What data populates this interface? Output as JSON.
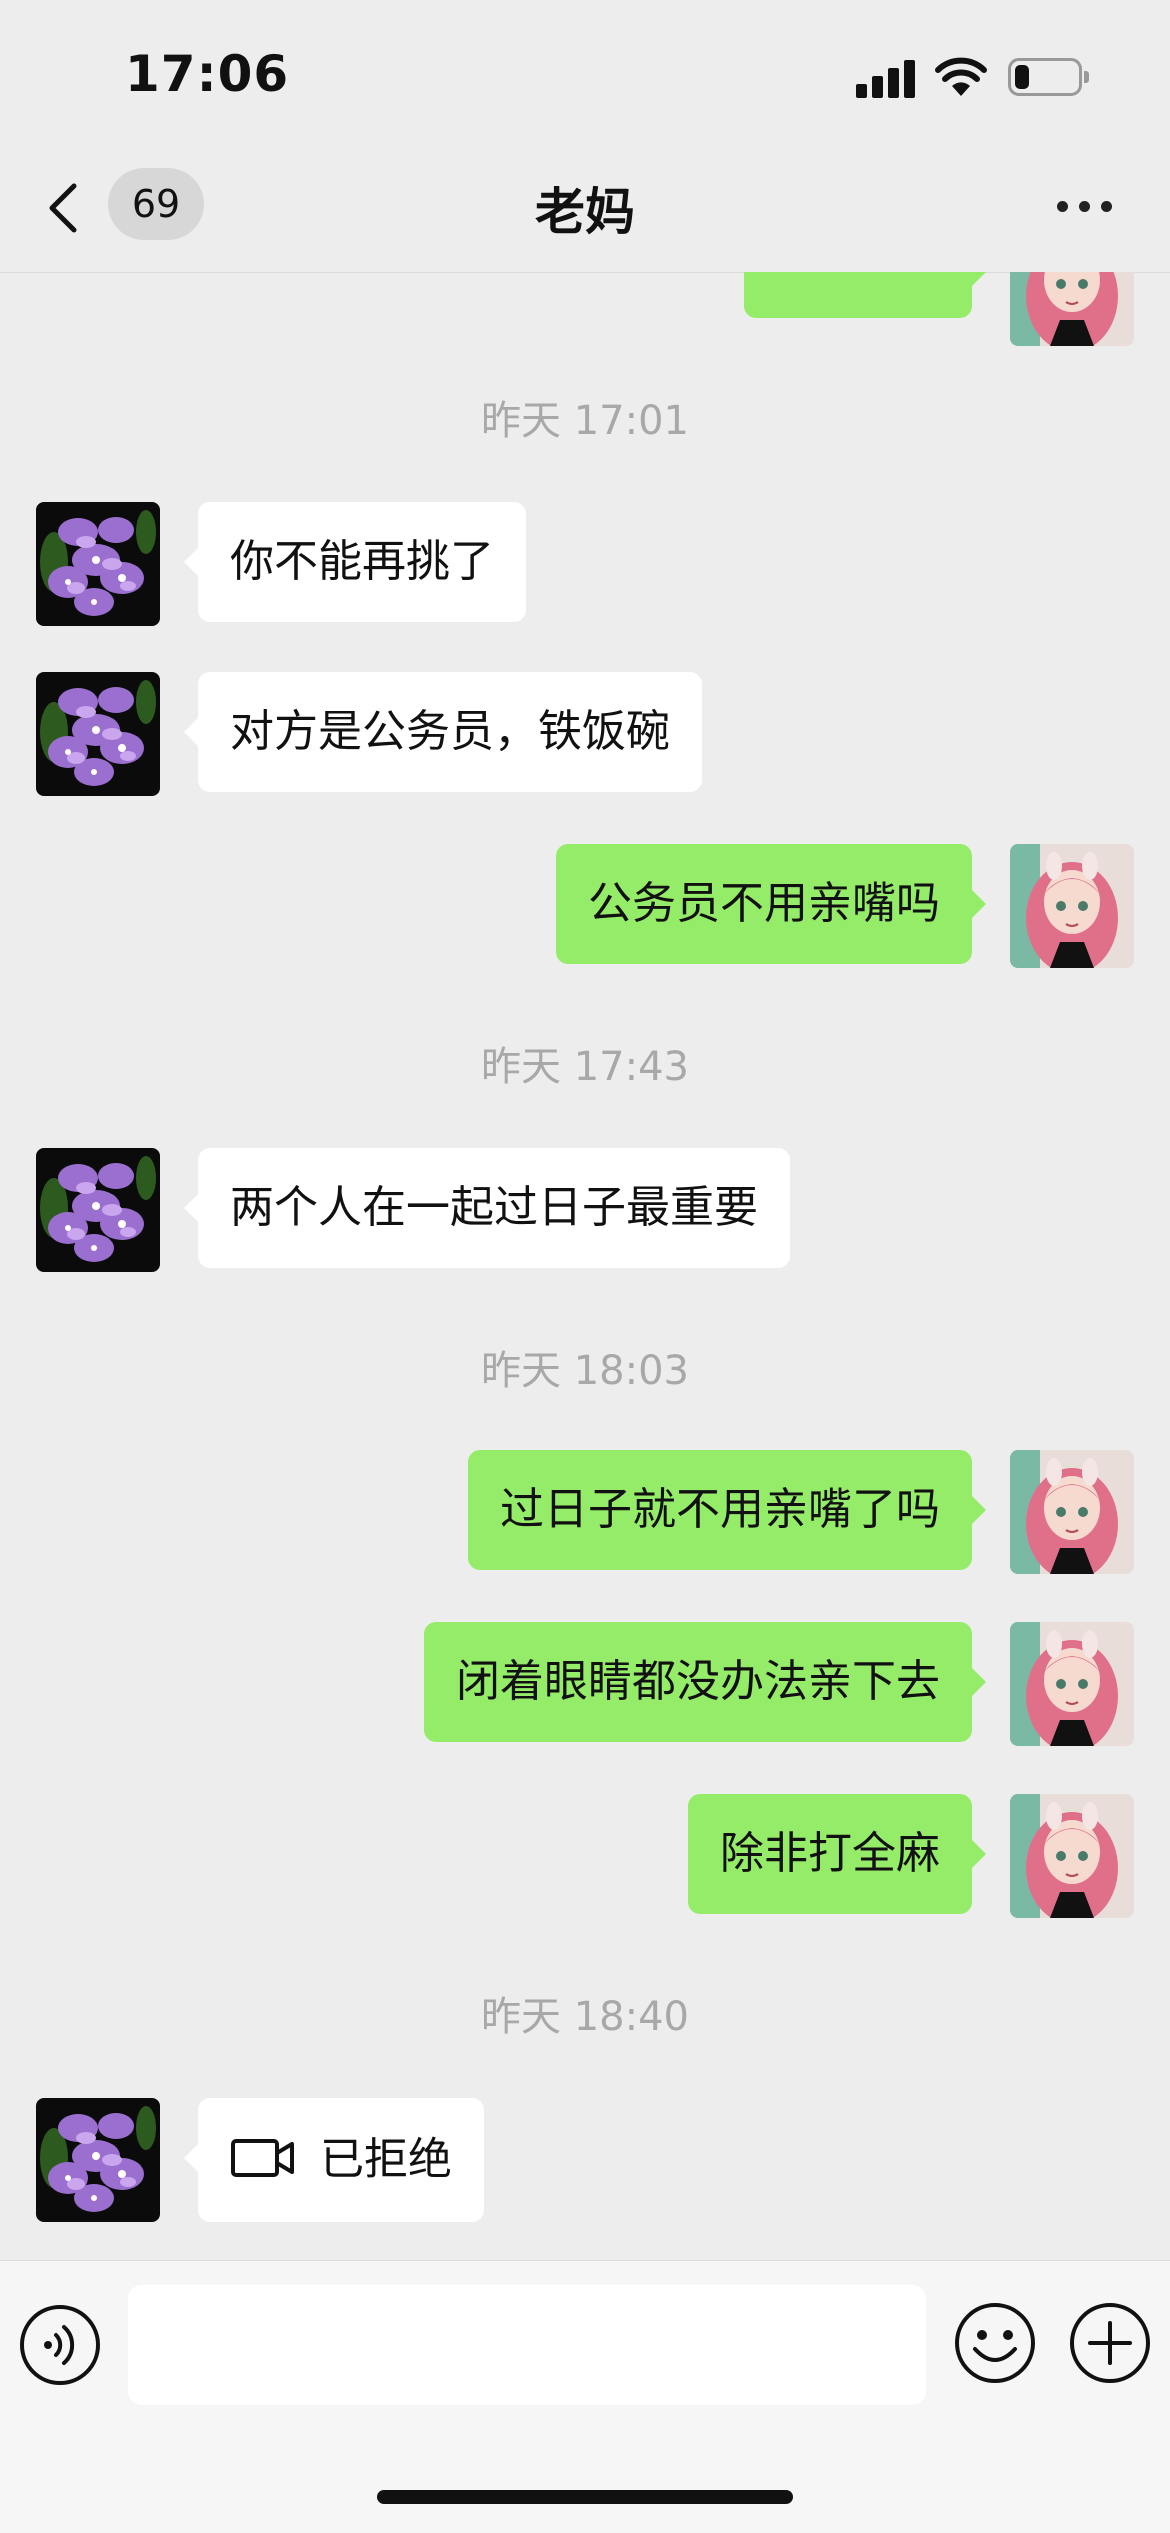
{
  "status_bar": {
    "time": "17:06"
  },
  "nav": {
    "unread_count": "69",
    "title": "老妈"
  },
  "chat": {
    "timestamps": [
      "昨天 17:01",
      "昨天 17:43",
      "昨天 18:03",
      "昨天 18:40"
    ],
    "messages": [
      {
        "direction": "in",
        "text": "你不能再挑了"
      },
      {
        "direction": "in",
        "text": "对方是公务员，铁饭碗"
      },
      {
        "direction": "out",
        "text": "公务员不用亲嘴吗"
      },
      {
        "direction": "in",
        "text": "两个人在一起过日子最重要"
      },
      {
        "direction": "out",
        "text": "过日子就不用亲嘴了吗"
      },
      {
        "direction": "out",
        "text": "闭着眼睛都没办法亲下去"
      },
      {
        "direction": "out",
        "text": "除非打全麻"
      },
      {
        "direction": "in",
        "type": "video-call",
        "text": "已拒绝"
      }
    ]
  },
  "input": {
    "value": ""
  },
  "colors": {
    "background": "#ededed",
    "outgoing_bubble": "#95ec69",
    "incoming_bubble": "#ffffff",
    "timestamp": "#a8a8a8"
  }
}
